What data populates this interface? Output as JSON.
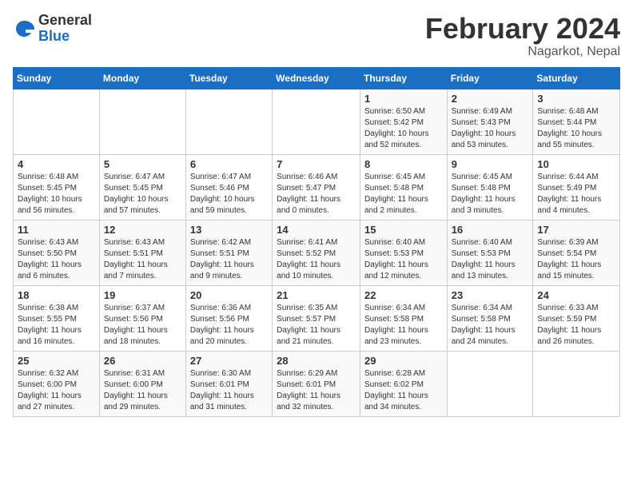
{
  "header": {
    "logo_general": "General",
    "logo_blue": "Blue",
    "month_title": "February 2024",
    "location": "Nagarkot, Nepal"
  },
  "days_of_week": [
    "Sunday",
    "Monday",
    "Tuesday",
    "Wednesday",
    "Thursday",
    "Friday",
    "Saturday"
  ],
  "weeks": [
    [
      {
        "day": "",
        "info": ""
      },
      {
        "day": "",
        "info": ""
      },
      {
        "day": "",
        "info": ""
      },
      {
        "day": "",
        "info": ""
      },
      {
        "day": "1",
        "info": "Sunrise: 6:50 AM\nSunset: 5:42 PM\nDaylight: 10 hours\nand 52 minutes."
      },
      {
        "day": "2",
        "info": "Sunrise: 6:49 AM\nSunset: 5:43 PM\nDaylight: 10 hours\nand 53 minutes."
      },
      {
        "day": "3",
        "info": "Sunrise: 6:48 AM\nSunset: 5:44 PM\nDaylight: 10 hours\nand 55 minutes."
      }
    ],
    [
      {
        "day": "4",
        "info": "Sunrise: 6:48 AM\nSunset: 5:45 PM\nDaylight: 10 hours\nand 56 minutes."
      },
      {
        "day": "5",
        "info": "Sunrise: 6:47 AM\nSunset: 5:45 PM\nDaylight: 10 hours\nand 57 minutes."
      },
      {
        "day": "6",
        "info": "Sunrise: 6:47 AM\nSunset: 5:46 PM\nDaylight: 10 hours\nand 59 minutes."
      },
      {
        "day": "7",
        "info": "Sunrise: 6:46 AM\nSunset: 5:47 PM\nDaylight: 11 hours\nand 0 minutes."
      },
      {
        "day": "8",
        "info": "Sunrise: 6:45 AM\nSunset: 5:48 PM\nDaylight: 11 hours\nand 2 minutes."
      },
      {
        "day": "9",
        "info": "Sunrise: 6:45 AM\nSunset: 5:48 PM\nDaylight: 11 hours\nand 3 minutes."
      },
      {
        "day": "10",
        "info": "Sunrise: 6:44 AM\nSunset: 5:49 PM\nDaylight: 11 hours\nand 4 minutes."
      }
    ],
    [
      {
        "day": "11",
        "info": "Sunrise: 6:43 AM\nSunset: 5:50 PM\nDaylight: 11 hours\nand 6 minutes."
      },
      {
        "day": "12",
        "info": "Sunrise: 6:43 AM\nSunset: 5:51 PM\nDaylight: 11 hours\nand 7 minutes."
      },
      {
        "day": "13",
        "info": "Sunrise: 6:42 AM\nSunset: 5:51 PM\nDaylight: 11 hours\nand 9 minutes."
      },
      {
        "day": "14",
        "info": "Sunrise: 6:41 AM\nSunset: 5:52 PM\nDaylight: 11 hours\nand 10 minutes."
      },
      {
        "day": "15",
        "info": "Sunrise: 6:40 AM\nSunset: 5:53 PM\nDaylight: 11 hours\nand 12 minutes."
      },
      {
        "day": "16",
        "info": "Sunrise: 6:40 AM\nSunset: 5:53 PM\nDaylight: 11 hours\nand 13 minutes."
      },
      {
        "day": "17",
        "info": "Sunrise: 6:39 AM\nSunset: 5:54 PM\nDaylight: 11 hours\nand 15 minutes."
      }
    ],
    [
      {
        "day": "18",
        "info": "Sunrise: 6:38 AM\nSunset: 5:55 PM\nDaylight: 11 hours\nand 16 minutes."
      },
      {
        "day": "19",
        "info": "Sunrise: 6:37 AM\nSunset: 5:56 PM\nDaylight: 11 hours\nand 18 minutes."
      },
      {
        "day": "20",
        "info": "Sunrise: 6:36 AM\nSunset: 5:56 PM\nDaylight: 11 hours\nand 20 minutes."
      },
      {
        "day": "21",
        "info": "Sunrise: 6:35 AM\nSunset: 5:57 PM\nDaylight: 11 hours\nand 21 minutes."
      },
      {
        "day": "22",
        "info": "Sunrise: 6:34 AM\nSunset: 5:58 PM\nDaylight: 11 hours\nand 23 minutes."
      },
      {
        "day": "23",
        "info": "Sunrise: 6:34 AM\nSunset: 5:58 PM\nDaylight: 11 hours\nand 24 minutes."
      },
      {
        "day": "24",
        "info": "Sunrise: 6:33 AM\nSunset: 5:59 PM\nDaylight: 11 hours\nand 26 minutes."
      }
    ],
    [
      {
        "day": "25",
        "info": "Sunrise: 6:32 AM\nSunset: 6:00 PM\nDaylight: 11 hours\nand 27 minutes."
      },
      {
        "day": "26",
        "info": "Sunrise: 6:31 AM\nSunset: 6:00 PM\nDaylight: 11 hours\nand 29 minutes."
      },
      {
        "day": "27",
        "info": "Sunrise: 6:30 AM\nSunset: 6:01 PM\nDaylight: 11 hours\nand 31 minutes."
      },
      {
        "day": "28",
        "info": "Sunrise: 6:29 AM\nSunset: 6:01 PM\nDaylight: 11 hours\nand 32 minutes."
      },
      {
        "day": "29",
        "info": "Sunrise: 6:28 AM\nSunset: 6:02 PM\nDaylight: 11 hours\nand 34 minutes."
      },
      {
        "day": "",
        "info": ""
      },
      {
        "day": "",
        "info": ""
      }
    ]
  ]
}
